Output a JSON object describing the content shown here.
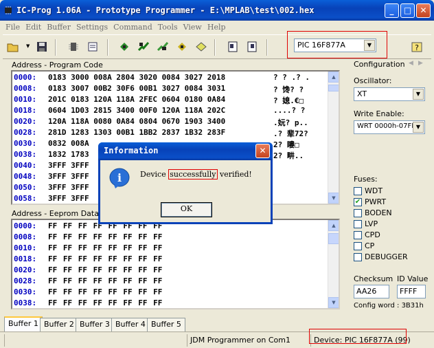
{
  "window": {
    "title": "IC-Prog 1.06A - Prototype Programmer - E:\\MPLAB\\test\\002.hex"
  },
  "menu": [
    "File",
    "Edit",
    "Buffer",
    "Settings",
    "Command",
    "Tools",
    "View",
    "Help"
  ],
  "toolbar": {
    "device_select": "PIC 16F877A"
  },
  "program_code": {
    "title": "Address - Program Code",
    "rows": [
      {
        "addr": "0000:",
        "data": "0183 3000 008A 2804 3020 0084 3027 2018",
        "ascii": "? ? .? ."
      },
      {
        "addr": "0008:",
        "data": "0183 3007 00B2 30F6 00B1 3027 0084 3031",
        "ascii": "? 馋? ?"
      },
      {
        "addr": "0010:",
        "data": "201C 0183 120A 118A 2FEC 0604 0180 0A84",
        "ascii": "? 媳.€□"
      },
      {
        "addr": "0018:",
        "data": "0604 1D03 2815 3400 00F0 120A 118A 202C",
        "ascii": "....? ?"
      },
      {
        "addr": "0020:",
        "data": "120A 118A 0080 0A84 0804 0670 1903 3400",
        "ascii": ".妧? p.."
      },
      {
        "addr": "0028:",
        "data": "281D 1283 1303 00B1 1BB2 2837 1B32 283F",
        "ascii": ".? 辈72?"
      },
      {
        "addr": "0030:",
        "data": "0832 008A",
        "ascii": "2? 瞜□"
      },
      {
        "addr": "0038:",
        "data": "1832 1783",
        "ascii": "2? 畊.."
      },
      {
        "addr": "0040:",
        "data": "3FFF 3FFF",
        "ascii": ""
      },
      {
        "addr": "0048:",
        "data": "3FFF 3FFF",
        "ascii": ""
      },
      {
        "addr": "0050:",
        "data": "3FFF 3FFF",
        "ascii": ""
      },
      {
        "addr": "0058:",
        "data": "3FFF 3FFF",
        "ascii": ""
      }
    ]
  },
  "eeprom": {
    "title": "Address - Eeprom Data",
    "rows": [
      {
        "addr": "0000:",
        "data": "FF FF FF FF FF FF FF FF"
      },
      {
        "addr": "0008:",
        "data": "FF FF FF FF FF FF FF FF"
      },
      {
        "addr": "0010:",
        "data": "FF FF FF FF FF FF FF FF"
      },
      {
        "addr": "0018:",
        "data": "FF FF FF FF FF FF FF FF"
      },
      {
        "addr": "0020:",
        "data": "FF FF FF FF FF FF FF FF"
      },
      {
        "addr": "0028:",
        "data": "FF FF FF FF FF FF FF FF"
      },
      {
        "addr": "0030:",
        "data": "FF FF FF FF FF FF FF FF"
      },
      {
        "addr": "0038:",
        "data": "FF FF FF FF FF FF FF FF"
      }
    ]
  },
  "config": {
    "title": "Configuration",
    "oscillator_label": "Oscillator:",
    "oscillator_value": "XT",
    "write_enable_label": "Write Enable:",
    "write_enable_value": "WRT 0000h-07FF",
    "fuses_label": "Fuses:",
    "fuses": [
      {
        "label": "WDT",
        "checked": false
      },
      {
        "label": "PWRT",
        "checked": true
      },
      {
        "label": "BODEN",
        "checked": false
      },
      {
        "label": "LVP",
        "checked": false
      },
      {
        "label": "CPD",
        "checked": false
      },
      {
        "label": "CP",
        "checked": false
      },
      {
        "label": "DEBUGGER",
        "checked": false
      }
    ],
    "checksum_label": "Checksum",
    "checksum_value": "AA26",
    "id_value_label": "ID Value",
    "id_value": "FFFF",
    "config_word": "Config word : 3B31h"
  },
  "tabs": [
    "Buffer 1",
    "Buffer 2",
    "Buffer 3",
    "Buffer 4",
    "Buffer 5"
  ],
  "status": {
    "programmer": "JDM Programmer on Com1",
    "device": "Device: PIC 16F877A  (99)"
  },
  "dialog": {
    "title": "Information",
    "message_before": "Device ",
    "message_highlight": "successfully",
    "message_after": " verified!",
    "ok_label": "OK"
  },
  "colors": {
    "highlight_box": "#e00000",
    "address_blue": "#0000c0",
    "title_blue": "#0842b8"
  }
}
